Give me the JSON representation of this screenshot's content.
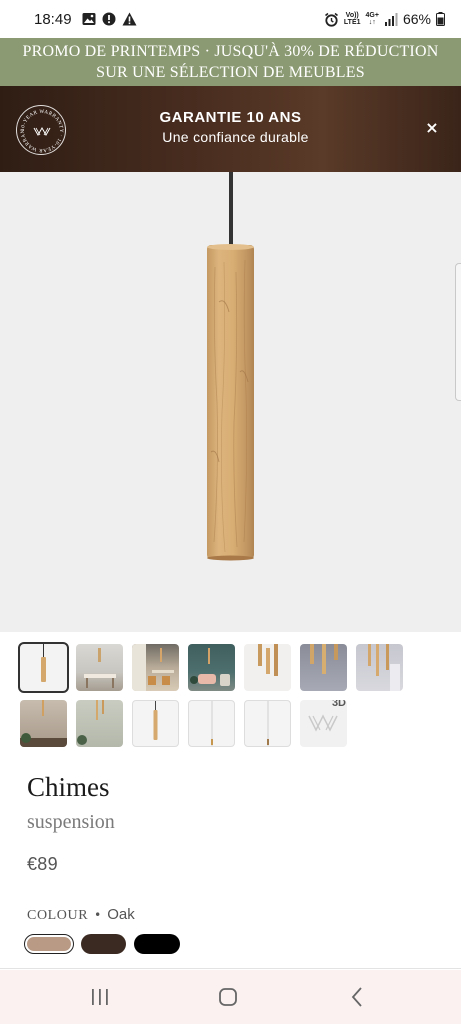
{
  "status_bar": {
    "time": "18:49",
    "network_top": "Vo))",
    "network_bottom": "LTE1",
    "data_top": "4G+",
    "battery": "66%"
  },
  "promo": {
    "line1": "PROMO DE PRINTEMPS · JUSQU'À 30% DE RÉDUCTION",
    "line2": "SUR UNE SÉLECTION DE MEUBLES"
  },
  "warranty": {
    "badge_text": "10-YEAR WARRANTY · 10-YEAR WARRANTY ·",
    "title": "GARANTIE 10 ANS",
    "subtitle": "Une confiance durable",
    "close_icon": "×"
  },
  "gallery": {
    "badge_3d": "3D"
  },
  "product": {
    "name": "Chimes",
    "type": "suspension",
    "price": "€89",
    "colour_label": "COLOUR",
    "colour_separator": "•",
    "colour_value": "Oak",
    "swatch_colors": [
      "#b89a85",
      "#3b2a22",
      "#000000"
    ]
  },
  "colors": {
    "promo_bg": "#8b9a72",
    "warranty_bg": "#4a2e20",
    "navbar_bg": "#fbf1f1"
  }
}
